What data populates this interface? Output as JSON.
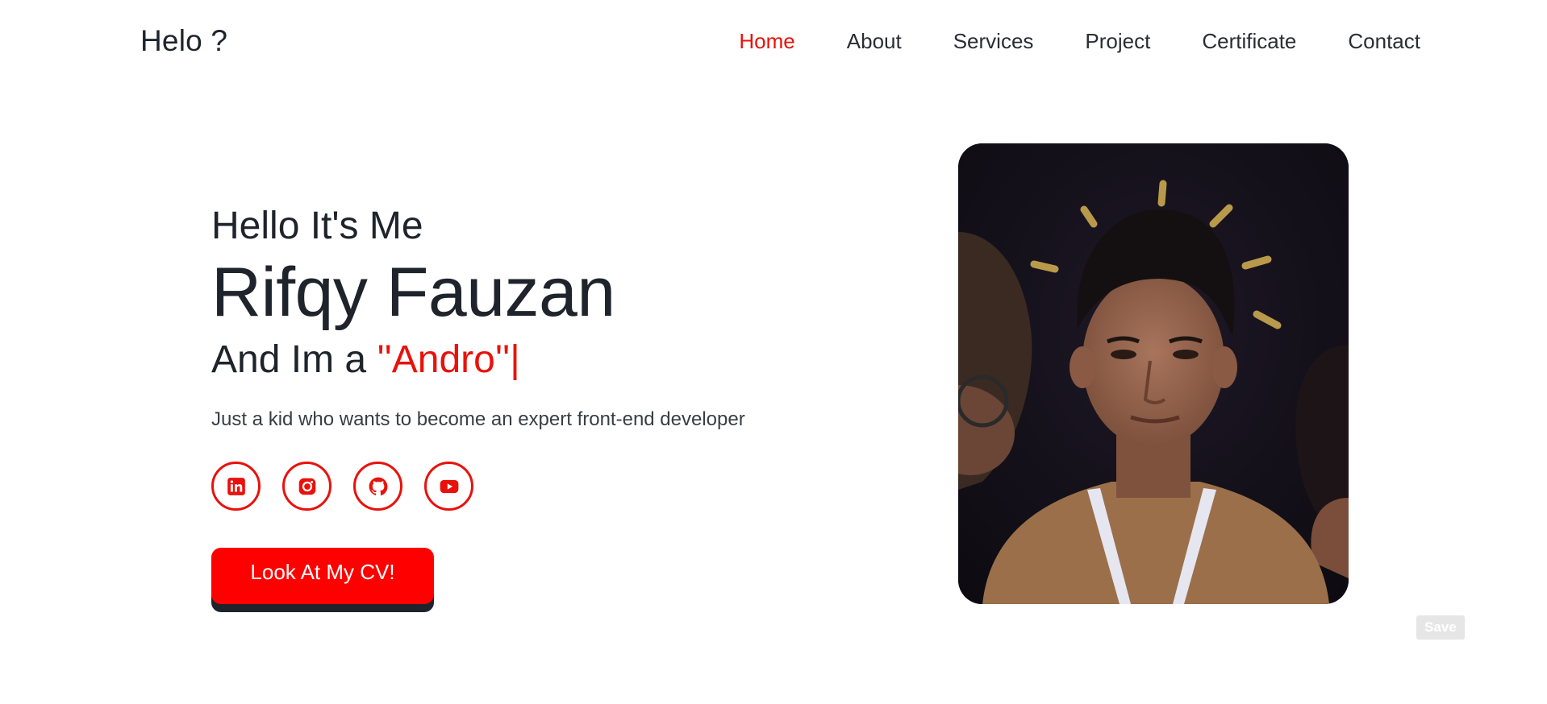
{
  "header": {
    "logo": "Helo ?",
    "nav": [
      {
        "label": "Home",
        "active": true
      },
      {
        "label": "About",
        "active": false
      },
      {
        "label": "Services",
        "active": false
      },
      {
        "label": "Project",
        "active": false
      },
      {
        "label": "Certificate",
        "active": false
      },
      {
        "label": "Contact",
        "active": false
      }
    ]
  },
  "hero": {
    "greeting": "Hello It's Me",
    "name": "Rifqy Fauzan",
    "role_prefix": "And Im a ",
    "role_highlight": "''Andro''",
    "role_cursor": "|",
    "tagline": "Just a kid who wants to become an expert front-end developer",
    "socials": [
      {
        "icon": "linkedin-icon"
      },
      {
        "icon": "instagram-icon"
      },
      {
        "icon": "github-icon"
      },
      {
        "icon": "youtube-icon"
      }
    ],
    "cv_button": "Look At My CV!"
  },
  "save_button": "Save",
  "colors": {
    "accent": "#e8120c",
    "button": "#ff0000",
    "text": "#1f232b"
  }
}
